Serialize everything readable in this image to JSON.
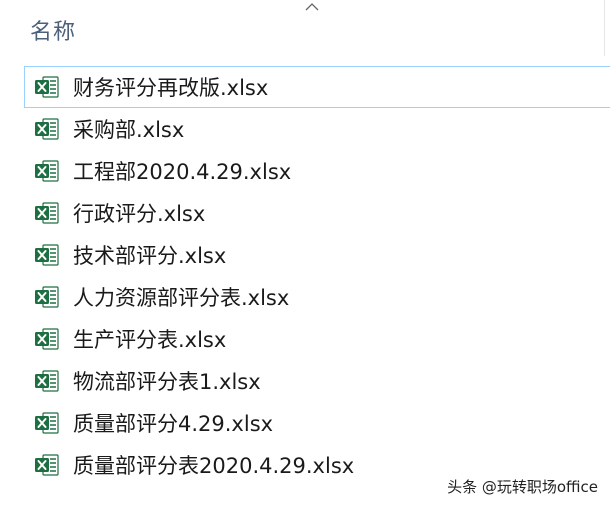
{
  "header": {
    "name_column_label": "名称",
    "sort_indicator_icon": "chevron-up-icon"
  },
  "files": [
    {
      "name": "财务评分再改版.xlsx",
      "icon": "excel-file-icon",
      "selected": true
    },
    {
      "name": "采购部.xlsx",
      "icon": "excel-file-icon",
      "selected": false
    },
    {
      "name": "工程部2020.4.29.xlsx",
      "icon": "excel-file-icon",
      "selected": false
    },
    {
      "name": "行政评分.xlsx",
      "icon": "excel-file-icon",
      "selected": false
    },
    {
      "name": "技术部评分.xlsx",
      "icon": "excel-file-icon",
      "selected": false
    },
    {
      "name": "人力资源部评分表.xlsx",
      "icon": "excel-file-icon",
      "selected": false
    },
    {
      "name": "生产评分表.xlsx",
      "icon": "excel-file-icon",
      "selected": false
    },
    {
      "name": "物流部评分表1.xlsx",
      "icon": "excel-file-icon",
      "selected": false
    },
    {
      "name": "质量部评分4.29.xlsx",
      "icon": "excel-file-icon",
      "selected": false
    },
    {
      "name": "质量部评分表2020.4.29.xlsx",
      "icon": "excel-file-icon",
      "selected": false
    }
  ],
  "watermark": "头条 @玩转职场office",
  "colors": {
    "excel_green": "#1d6f42",
    "selection_border": "#99d1ff",
    "header_text": "#4c607a"
  }
}
